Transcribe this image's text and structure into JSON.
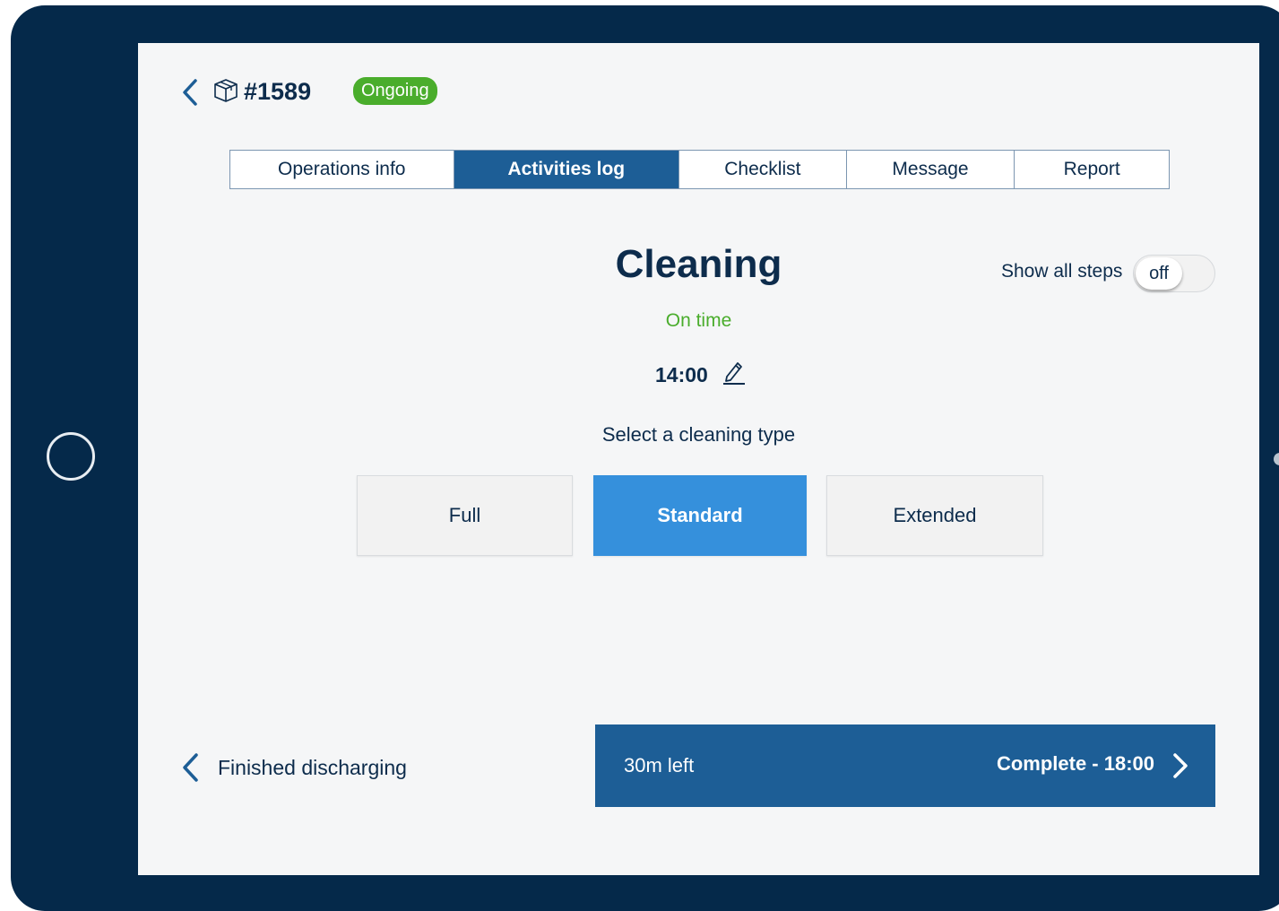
{
  "header": {
    "job_number": "#1589",
    "status": "Ongoing",
    "back_icon": "chevron-left-icon",
    "job_icon": "package-box-icon"
  },
  "tabs": [
    {
      "label": "Operations info",
      "active": false
    },
    {
      "label": "Activities log",
      "active": true
    },
    {
      "label": "Checklist",
      "active": false
    },
    {
      "label": "Message",
      "active": false
    },
    {
      "label": "Report",
      "active": false
    }
  ],
  "activity": {
    "title": "Cleaning",
    "status": "On time",
    "time": "14:00",
    "edit_icon": "pencil-icon",
    "select_prompt": "Select a cleaning type"
  },
  "show_all_steps": {
    "label": "Show all steps",
    "state": "off"
  },
  "cleaning_types": [
    {
      "label": "Full",
      "selected": false
    },
    {
      "label": "Standard",
      "selected": true
    },
    {
      "label": "Extended",
      "selected": false
    }
  ],
  "footer": {
    "previous_step": "Finished discharging",
    "time_left": "30m left",
    "complete_label": "Complete - 18:00"
  },
  "colors": {
    "device_frame": "#05294a",
    "primary": "#1d5e96",
    "selected_button": "#3590dc",
    "success": "#4aad2c",
    "text": "#0d2c4c",
    "screen_background": "#f5f6f7"
  }
}
